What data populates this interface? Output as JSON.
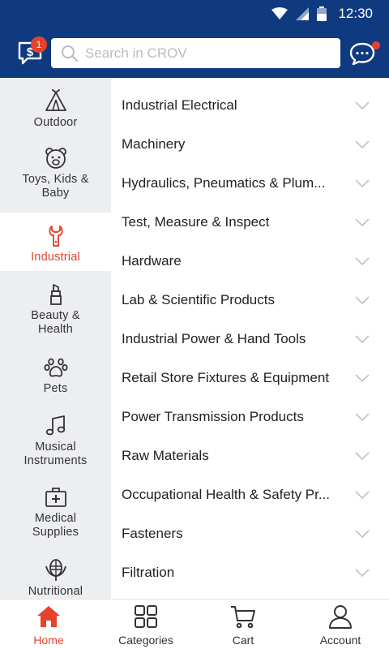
{
  "status_bar": {
    "time": "12:30"
  },
  "header": {
    "quote_badge_count": "1",
    "search_placeholder": "Search in CROV"
  },
  "sidebar": {
    "items": [
      {
        "label": "Outdoor",
        "icon": "tent-icon",
        "active": false
      },
      {
        "label": "Toys, Kids & Baby",
        "icon": "teddy-bear-icon",
        "active": false
      },
      {
        "label": "Industrial",
        "icon": "wrench-icon",
        "active": true
      },
      {
        "label": "Beauty & Health",
        "icon": "lipstick-icon",
        "active": false
      },
      {
        "label": "Pets",
        "icon": "paw-icon",
        "active": false
      },
      {
        "label": "Musical Instruments",
        "icon": "music-note-icon",
        "active": false
      },
      {
        "label": "Medical Supplies",
        "icon": "first-aid-kit-icon",
        "active": false
      },
      {
        "label": "Nutritional Ingredients",
        "icon": "grain-icon",
        "active": false
      }
    ]
  },
  "categories": [
    "Industrial Electrical",
    "Machinery",
    "Hydraulics, Pneumatics & Plum...",
    "Test, Measure & Inspect",
    "Hardware",
    "Lab & Scientific Products",
    "Industrial Power & Hand Tools",
    "Retail Store Fixtures & Equipment",
    "Power Transmission Products",
    "Raw Materials",
    "Occupational Health & Safety Pr...",
    "Fasteners",
    "Filtration"
  ],
  "bottom_nav": {
    "items": [
      {
        "label": "Home",
        "icon": "home-icon",
        "active": true
      },
      {
        "label": "Categories",
        "icon": "grid-icon",
        "active": false
      },
      {
        "label": "Cart",
        "icon": "cart-icon",
        "active": false
      },
      {
        "label": "Account",
        "icon": "user-icon",
        "active": false
      }
    ]
  },
  "colors": {
    "brand_blue": "#0f3a80",
    "accent_red": "#e8412b",
    "sidebar_bg": "#eceef1"
  }
}
